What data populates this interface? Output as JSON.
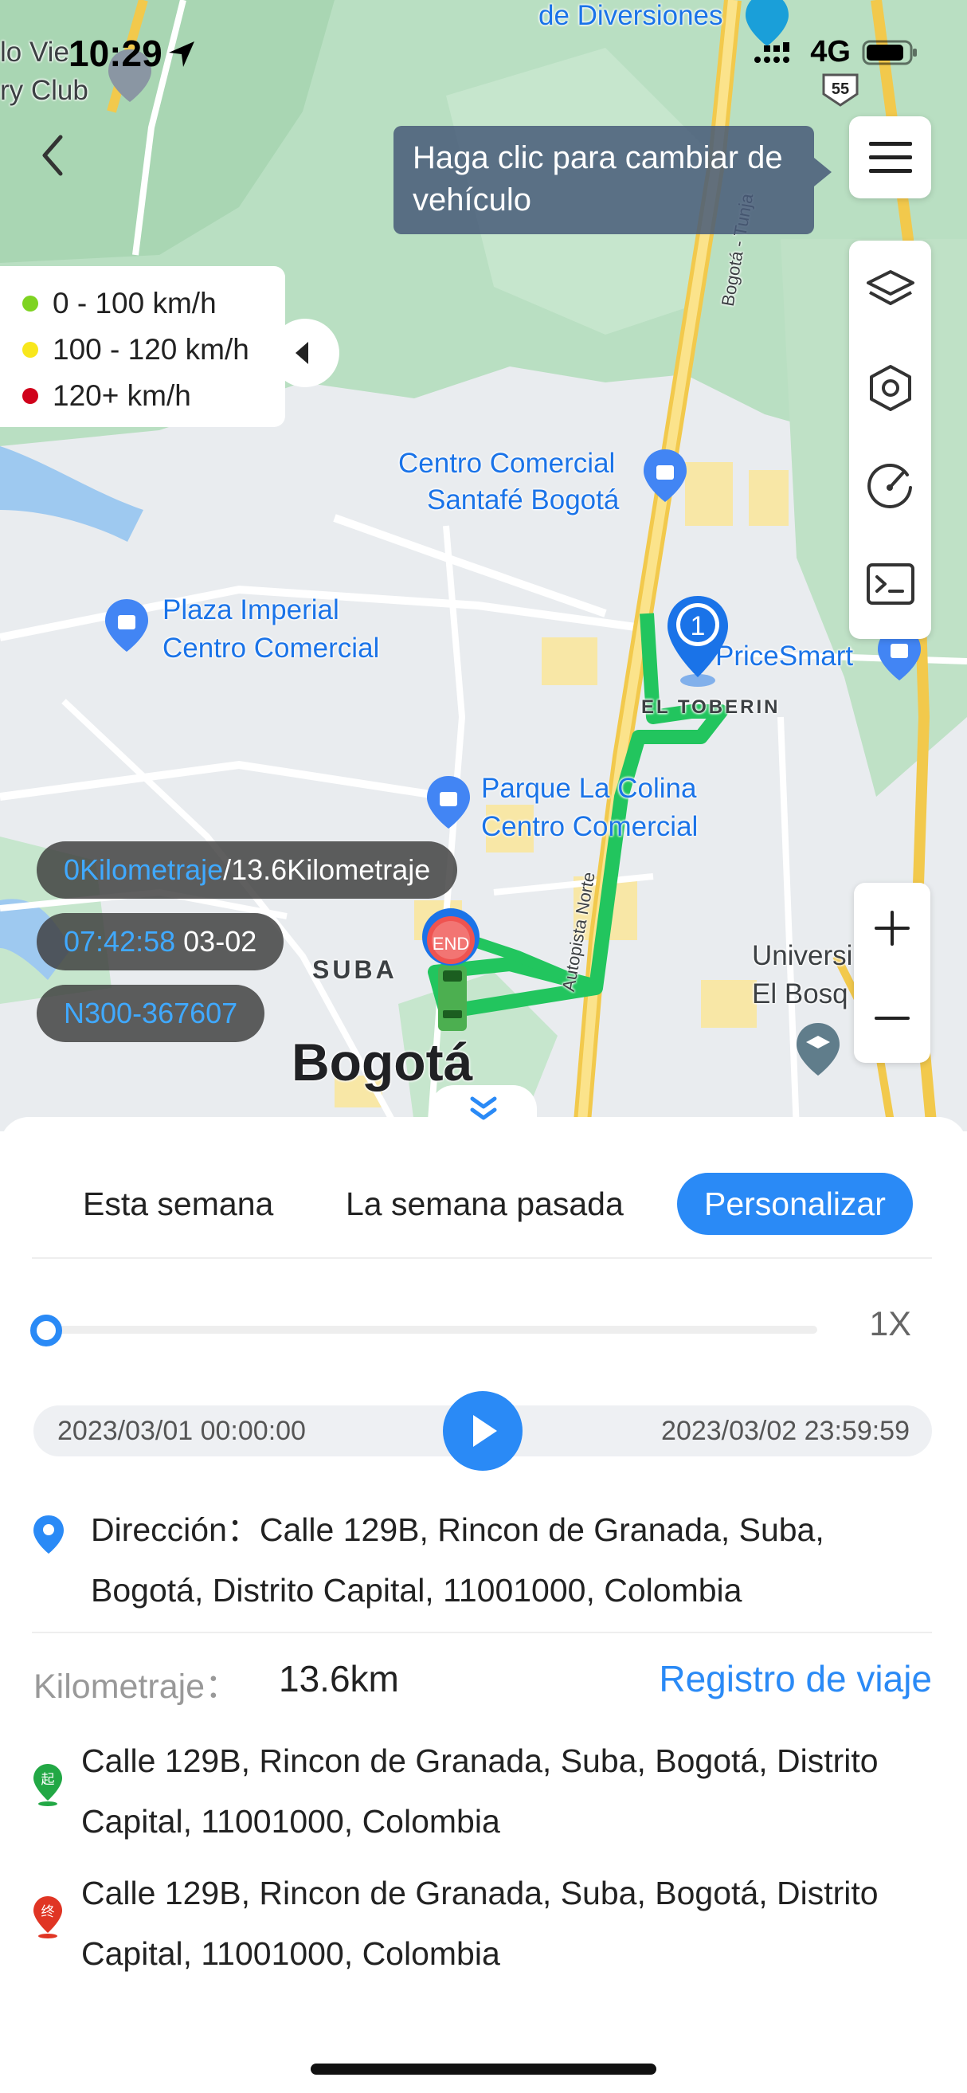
{
  "status_bar": {
    "time": "10:29",
    "network": "4G"
  },
  "map": {
    "vehicle_tip": "Haga clic para cambiar de vehículo",
    "speed_legend": [
      {
        "label": "0 - 100 km/h",
        "color": "#7ed321"
      },
      {
        "label": "100 - 120 km/h",
        "color": "#f8e71c"
      },
      {
        "label": "120+ km/h",
        "color": "#d0021b"
      }
    ],
    "labels": {
      "de_diversiones": "de Diversiones",
      "country_a": "lo Vie",
      "country_b": "ry Club",
      "cc_santafe_1": "Centro Comercial",
      "cc_santafe_2": "Santafé Bogotá",
      "plaza_1": "Plaza Imperial",
      "plaza_2": "Centro Comercial",
      "pricesmart": "PriceSmart",
      "el_toberin": "EL TOBERIN",
      "colina_1": "Parque La Colina",
      "colina_2": "Centro Comercial",
      "suba": "SUBA",
      "bogota": "Bogotá",
      "universidad_1": "Universi",
      "universidad_2": "El Bosq",
      "autopista_norte": "Autopista Norte",
      "bogota_tunja": "Bogotá - Tunja",
      "highway_55": "55",
      "start_marker": "1",
      "end_marker": "END"
    },
    "pills": {
      "mileage_current": "0Kilometraje",
      "mileage_sep": "/",
      "mileage_total": "13.6Kilometraje",
      "time": "07:42:58",
      "date": "03-02",
      "device": "N300-367607"
    }
  },
  "panel": {
    "tabs": [
      {
        "label": "Esta semana",
        "active": false
      },
      {
        "label": "La semana pasada",
        "active": false
      },
      {
        "label": "Personalizar",
        "active": true
      }
    ],
    "playback": {
      "progress": 0.0,
      "rate": "1X",
      "start": "2023/03/01 00:00:00",
      "end": "2023/03/02 23:59:59"
    },
    "address_label": "Dirección：",
    "address_value": "Calle 129B, Rincon de Granada, Suba, Bogotá, Distrito Capital, 11001000, Colombia",
    "mileage_label": "Kilometraje：",
    "mileage_value": "13.6km",
    "trip_log": "Registro de viaje",
    "trip_start_icon_char": "起",
    "trip_end_icon_char": "终",
    "trip_start": "Calle 129B, Rincon de Granada, Suba, Bogotá, Distrito Capital, 11001000, Colombia",
    "trip_end": "Calle 129B, Rincon de Granada, Suba, Bogotá, Distrito Capital, 11001000, Colombia"
  },
  "icons": {
    "back": "chevron-left-icon",
    "menu": "hamburger-menu-icon",
    "layers": "layers-icon",
    "hexagon": "geofence-icon",
    "speedometer": "speedometer-icon",
    "terminal": "command-icon",
    "zoom_in": "plus-icon",
    "zoom_out": "minus-icon",
    "play": "play-icon",
    "collapse": "double-chevron-down-icon"
  }
}
